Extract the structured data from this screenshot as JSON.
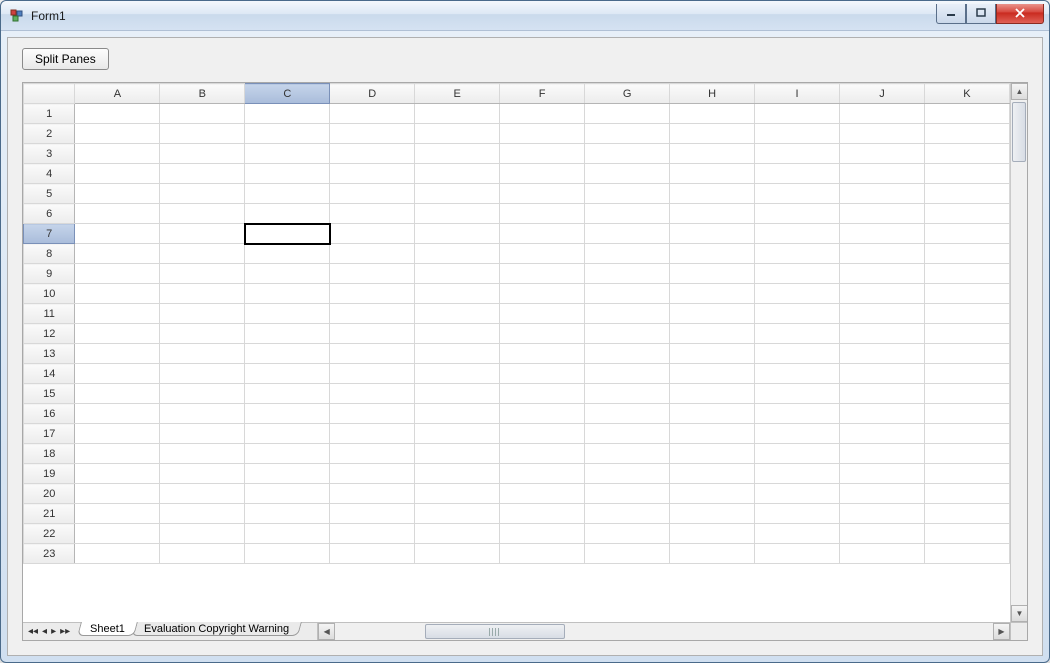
{
  "window": {
    "title": "Form1"
  },
  "toolbar": {
    "split_panes_label": "Split Panes"
  },
  "spreadsheet": {
    "columns": [
      "A",
      "B",
      "C",
      "D",
      "E",
      "F",
      "G",
      "H",
      "I",
      "J",
      "K"
    ],
    "rows": [
      "1",
      "2",
      "3",
      "4",
      "5",
      "6",
      "7",
      "8",
      "9",
      "10",
      "11",
      "12",
      "13",
      "14",
      "15",
      "16",
      "17",
      "18",
      "19",
      "20",
      "21",
      "22",
      "23"
    ],
    "selected_col": "C",
    "selected_row": "7",
    "tabs": [
      {
        "label": "Sheet1",
        "active": true
      },
      {
        "label": "Evaluation Copyright Warning",
        "active": false
      }
    ]
  }
}
